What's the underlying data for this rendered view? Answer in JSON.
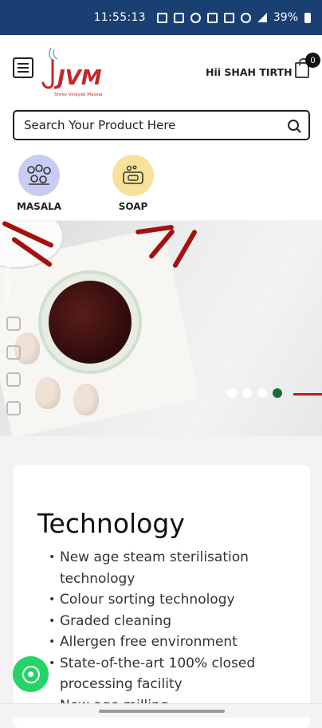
{
  "status_bar": {
    "time": "11:55:13",
    "battery": "39%",
    "icons": [
      "laptop-icon",
      "grid-icon",
      "alarm-icon",
      "calendar-icon",
      "vibrate-icon",
      "wifi-icon",
      "signal-icon",
      "battery-icon"
    ]
  },
  "header": {
    "brand": "Shree Vinayak Masala",
    "brand_initials": "JVM",
    "greeting": "Hii SHAH TIRTH",
    "cart_count": "0"
  },
  "search": {
    "placeholder": "Search Your Product Here"
  },
  "categories": [
    {
      "label": "MASALA",
      "icon": "masala-icon",
      "color": "#c9ccf2"
    },
    {
      "label": "SOAP",
      "icon": "soap-icon",
      "color": "#f7e29a"
    }
  ],
  "banner": {
    "follow_label": "Follow Us",
    "social": [
      "facebook-icon",
      "twitter-icon",
      "instagram-icon",
      "youtube-icon"
    ],
    "slides_total": 4,
    "active_slide": 4
  },
  "technology": {
    "title": "Technology",
    "items": [
      "New age steam sterilisation technology",
      "Colour sorting technology",
      "Graded cleaning",
      "Allergen free environment",
      "State-of-the-art 100% closed processing facility",
      "New age milling"
    ]
  },
  "colors": {
    "status_bar": "#1a3f73",
    "accent_red": "#c01b1b",
    "active_dot": "#1e6b3a",
    "whatsapp": "#25d366"
  }
}
